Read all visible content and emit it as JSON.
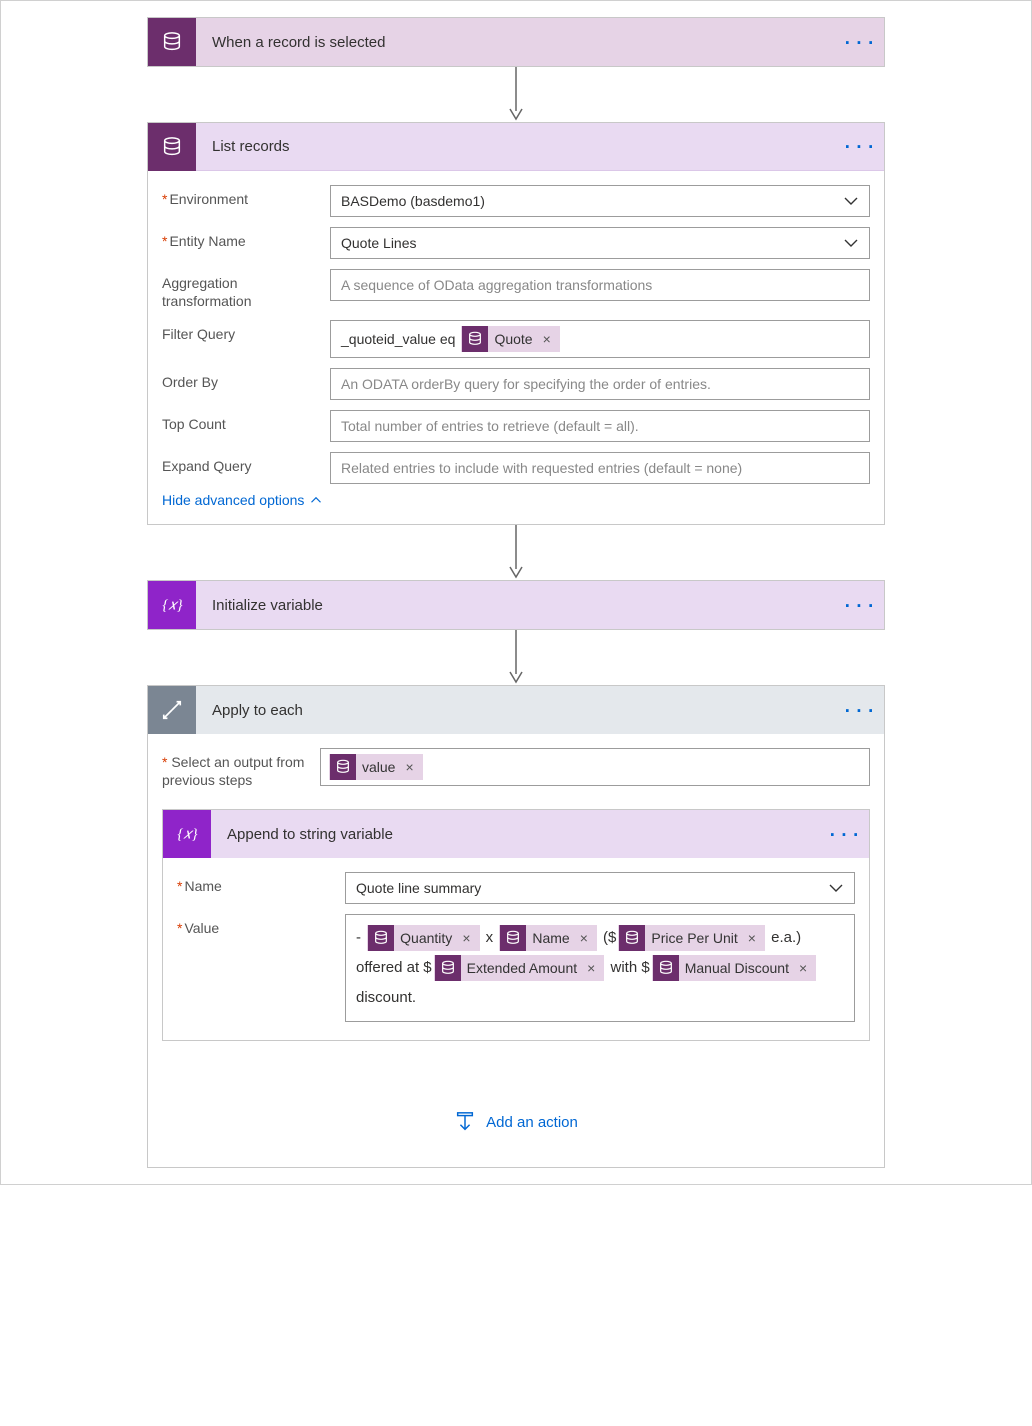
{
  "step1": {
    "title": "When a record is selected"
  },
  "step2": {
    "title": "List records",
    "labels": {
      "env": "Environment",
      "entity": "Entity Name",
      "agg": "Aggregation transformation",
      "filter": "Filter Query",
      "order": "Order By",
      "top": "Top Count",
      "expand": "Expand Query"
    },
    "values": {
      "env": "BASDemo (basdemo1)",
      "entity": "Quote Lines",
      "filter_prefix": "_quoteid_value eq"
    },
    "placeholders": {
      "agg": "A sequence of OData aggregation transformations",
      "order": "An ODATA orderBy query for specifying the order of entries.",
      "top": "Total number of entries to retrieve (default = all).",
      "expand": "Related entries to include with requested entries (default = none)"
    },
    "tokens": {
      "quote": "Quote"
    },
    "hide_link": "Hide advanced options"
  },
  "step3": {
    "title": "Initialize variable"
  },
  "step4": {
    "title": "Apply to each",
    "select_label": "Select an output from previous steps",
    "tokens": {
      "value": "value"
    },
    "add_action": "Add an action"
  },
  "step5": {
    "title": "Append to string variable",
    "labels": {
      "name": "Name",
      "value": "Value"
    },
    "values": {
      "name": "Quote line summary"
    },
    "tokens": {
      "quantity": "Quantity",
      "name": "Name",
      "ppu": "Price Per Unit",
      "ext": "Extended Amount",
      "disc": "Manual Discount"
    },
    "text": {
      "dash": "- ",
      "x": " x ",
      "paren_dollar": " ($",
      "ea": " e.a.) offered at $",
      "with": " with $",
      "discount": " discount."
    }
  }
}
